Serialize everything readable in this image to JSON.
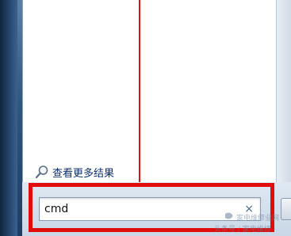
{
  "start_menu": {
    "more_results_label": "查看更多结果",
    "search": {
      "value": "cmd",
      "clear_glyph": "×"
    }
  },
  "icons": {
    "more_results": "search-magnifier-icon",
    "clear": "clear-search-icon"
  },
  "watermark": {
    "line1": "家电维修业网",
    "line2": "头条号 / 家电维修"
  },
  "colors": {
    "highlight": "#e10d0d",
    "divider": "#d41515",
    "link_text": "#0c2f6a",
    "frame_blue": "#2f5680"
  }
}
